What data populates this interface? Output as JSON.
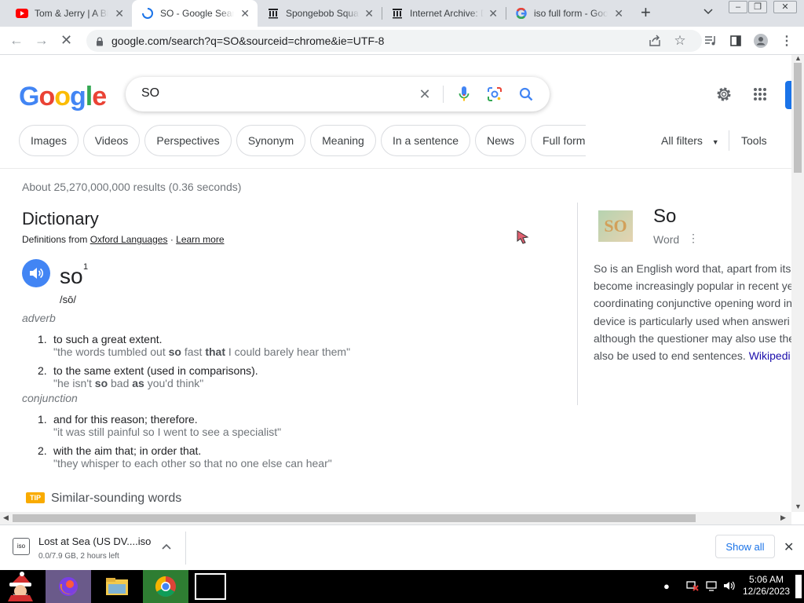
{
  "tabs": [
    {
      "title": "Tom & Jerry | A Bi",
      "favicon": "youtube-icon"
    },
    {
      "title": "SO - Google Search",
      "favicon": "loading-spinner-icon"
    },
    {
      "title": "Spongebob Squa",
      "favicon": "internet-archive-icon"
    },
    {
      "title": "Internet Archive: D",
      "favicon": "internet-archive-icon"
    },
    {
      "title": "iso full form - Goo",
      "favicon": "google-icon"
    }
  ],
  "address": {
    "url": "google.com/search?q=SO&sourceid=chrome&ie=UTF-8"
  },
  "google": {
    "logo": "Google",
    "query": "SO",
    "chips": [
      "Images",
      "Videos",
      "Perspectives",
      "Synonym",
      "Meaning",
      "In a sentence",
      "News",
      "Full form"
    ],
    "all_filters": "All filters",
    "tools": "Tools",
    "stats": "About 25,270,000,000 results (0.36 seconds)"
  },
  "dictionary": {
    "title": "Dictionary",
    "source_prefix": "Definitions from",
    "source": "Oxford Languages",
    "learn_more": "Learn more",
    "word": "so",
    "sup": "1",
    "phonetic": "/sō/",
    "groups": [
      {
        "pos": "adverb",
        "defs": [
          {
            "num": "1.",
            "text": "to such a great extent.",
            "ex_a": "\"the words tumbled out ",
            "ex_b1": "so",
            "ex_mid": " fast ",
            "ex_b2": "that",
            "ex_c": " I could barely hear them\""
          },
          {
            "num": "2.",
            "text": "to the same extent (used in comparisons).",
            "ex_a": "\"he isn't ",
            "ex_b1": "so",
            "ex_mid": " bad ",
            "ex_b2": "as",
            "ex_c": " you'd think\""
          }
        ]
      },
      {
        "pos": "conjunction",
        "defs": [
          {
            "num": "1.",
            "text": "and for this reason; therefore.",
            "example": "\"it was still painful so I went to see a specialist\""
          },
          {
            "num": "2.",
            "text": "with the aim that; in order that.",
            "example": "\"they whisper to each other so that no one else can hear\""
          }
        ]
      }
    ],
    "tip": "TIP",
    "similar": "Similar-sounding words"
  },
  "knowledge": {
    "title": "So",
    "subtitle": "Word",
    "thumb_text": "SO",
    "lines": [
      "So is an English word that, apart from its",
      "become increasingly popular in recent ye",
      "coordinating conjunctive opening word in",
      "device is particularly used when answeri",
      "although the questioner may also use the"
    ],
    "last_line": "also be used to end sentences. ",
    "link": "Wikipedi"
  },
  "download": {
    "icon_text": "iso",
    "name": "Lost at Sea (US DV....iso",
    "status": "0.0/7.9 GB, 2 hours left",
    "show_all": "Show all"
  },
  "taskbar": {
    "time": "5:06 AM",
    "date": "12/26/2023"
  },
  "colors": {
    "google_blue": "#4285f4",
    "link": "#1a0dab",
    "accent": "#1a73e8",
    "youtube": "#ff0000"
  }
}
